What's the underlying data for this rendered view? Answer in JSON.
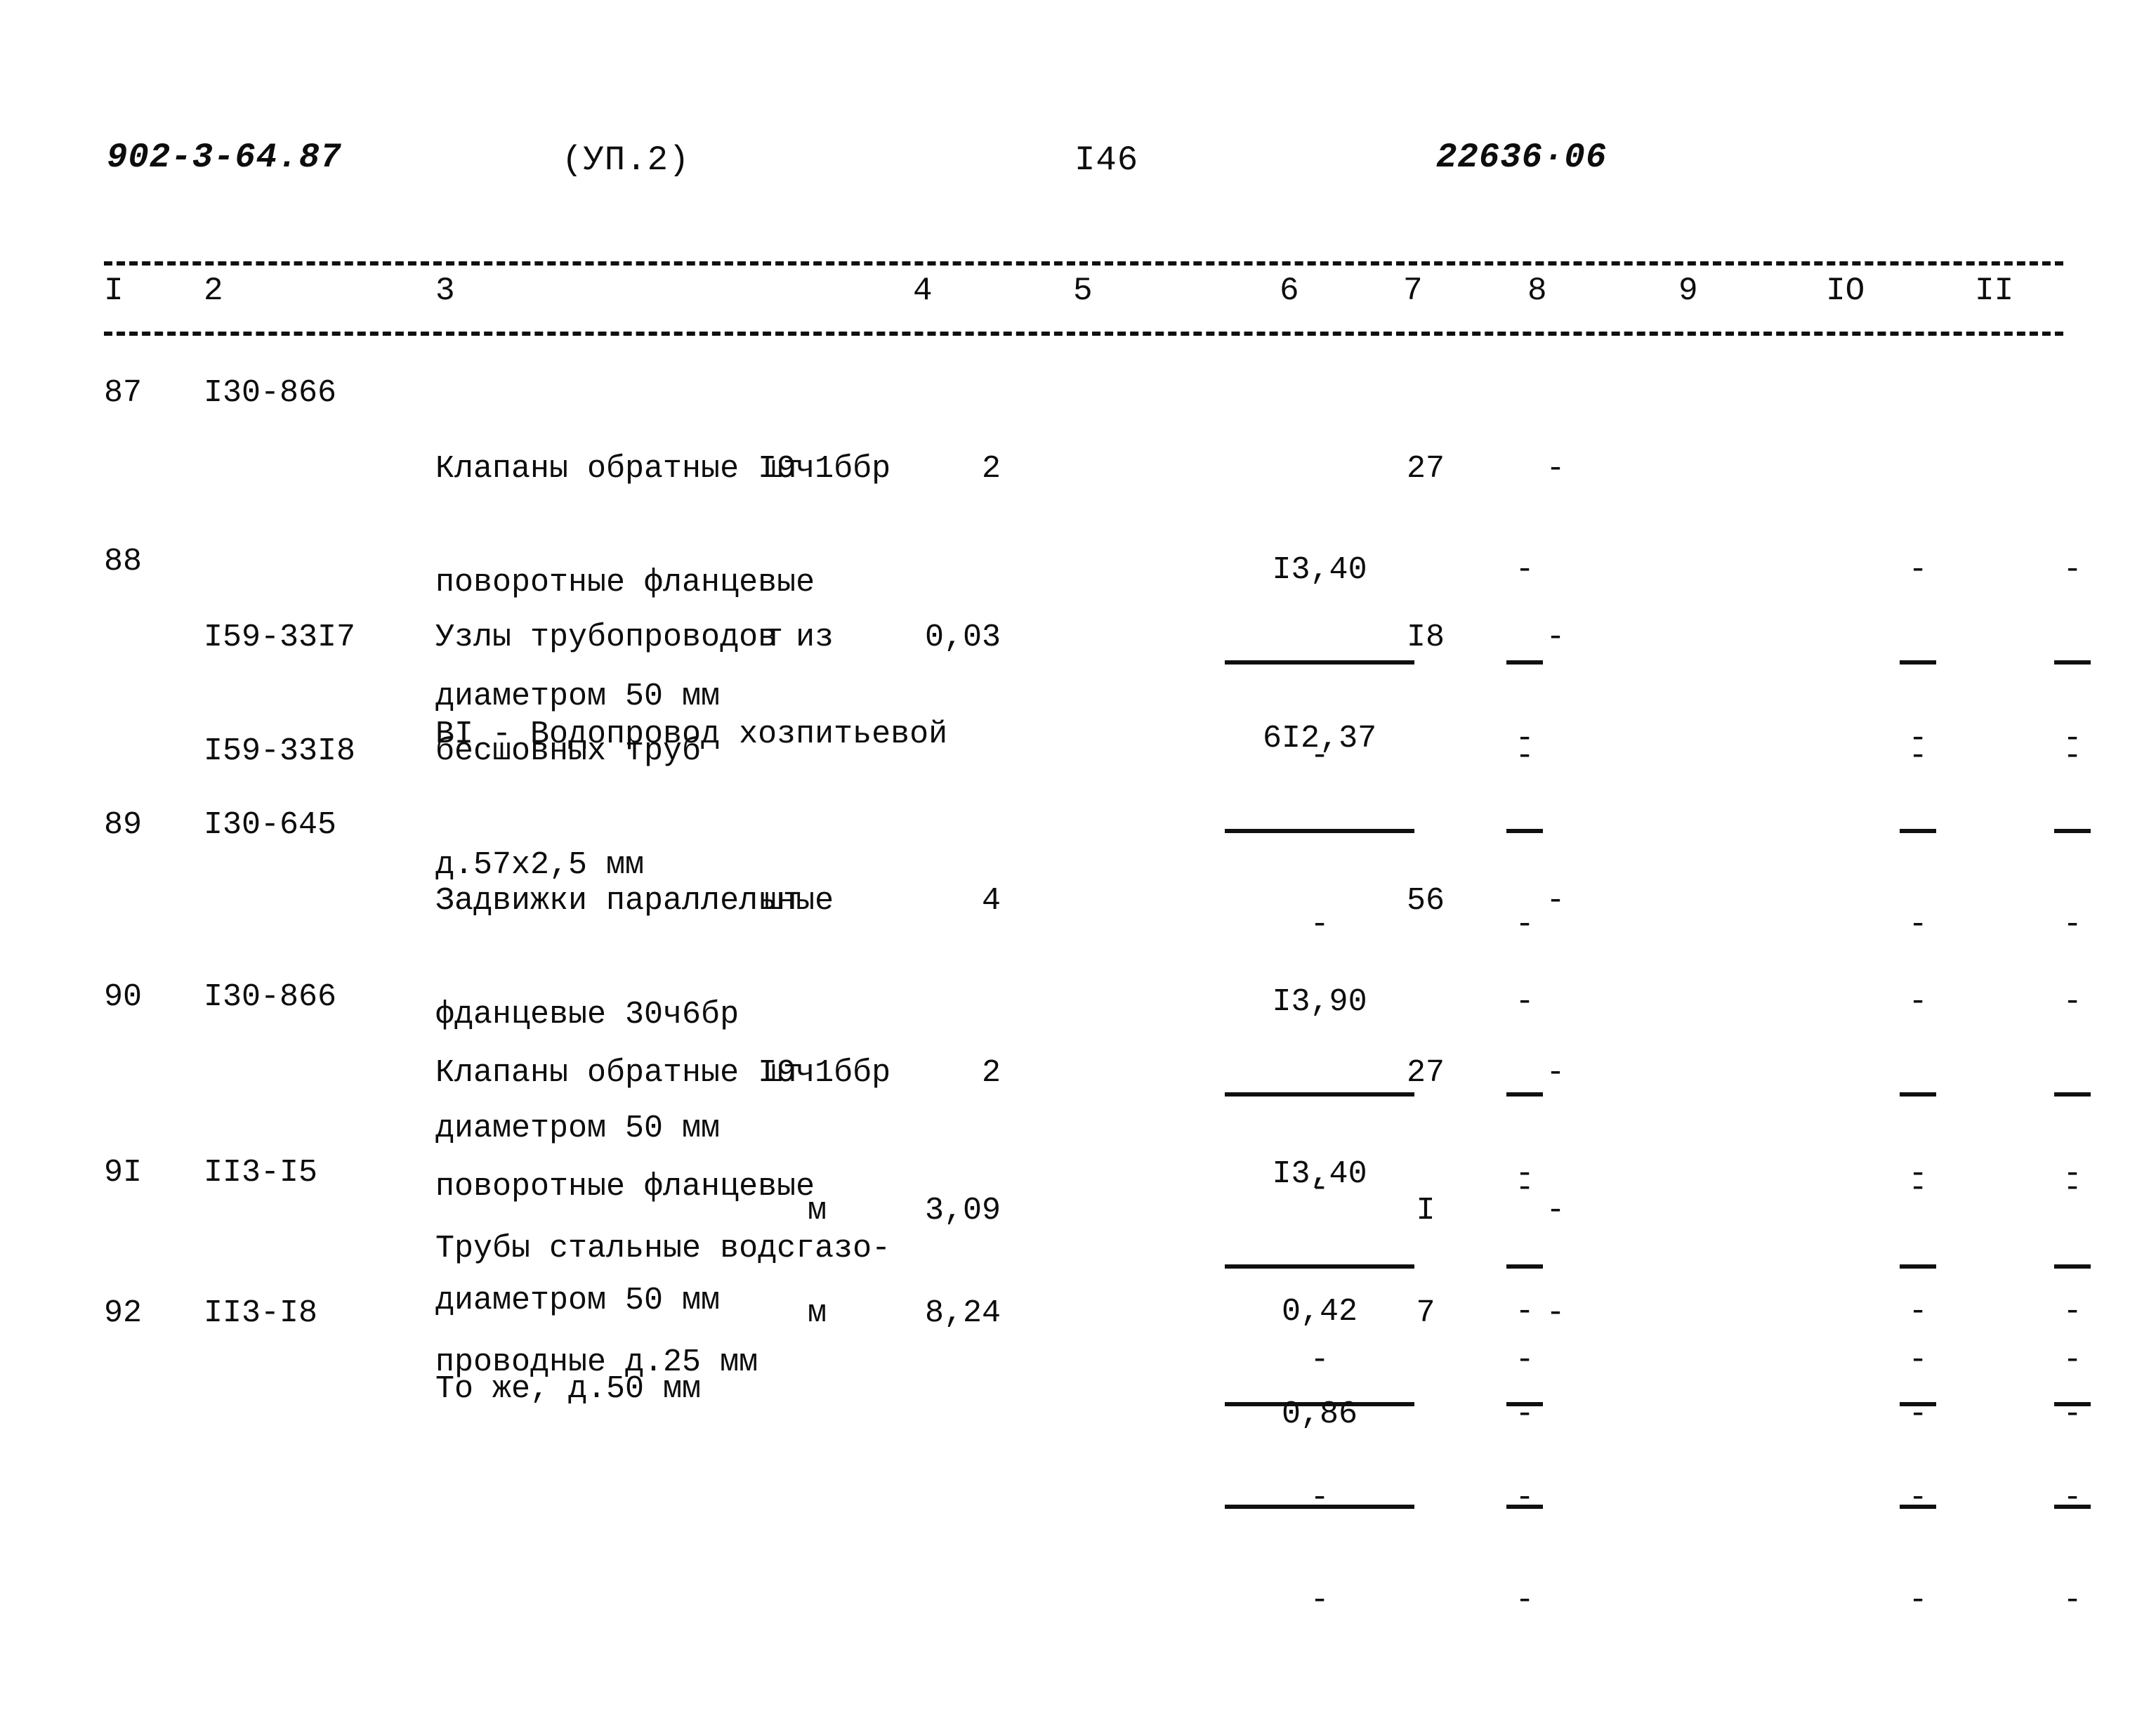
{
  "header": {
    "series_code": "902-3-64.87",
    "part_label": "(УП.2)",
    "page_number": "I46",
    "doc_number": "22636·06"
  },
  "table": {
    "column_numbers": [
      "I",
      "2",
      "3",
      "4",
      "5",
      "6",
      "7",
      "8",
      "9",
      "IO",
      "II"
    ],
    "rows": [
      {
        "kind": "item",
        "no": "87",
        "code_line1": "I30-866",
        "code_line2": "",
        "desc_line1": "Клапаны обратные I9ч1ббр",
        "desc_line2": "поворотные фланцевые",
        "desc_line3": "диаметром 50 мм",
        "unit": "шт",
        "qty": "2",
        "col5_num": "I3,40",
        "col5_den": "-",
        "col6_num": "-",
        "col6_den": "-",
        "col7": "27",
        "col8": "-",
        "col9_num": "-",
        "col9_den": "-",
        "col10_num": "-",
        "col10_den": "-",
        "col11_num": "-",
        "col11_den": "-"
      },
      {
        "kind": "item",
        "no": "88",
        "code_line1": "I59-33I7",
        "code_line2": "I59-33I8",
        "desc_line1": "Узлы трубопроводов из",
        "desc_line2": "бесшовных труб",
        "desc_line3": "д.57х2,5 мм",
        "unit": "т",
        "qty": "0,03",
        "col5_num": "6I2,37",
        "col5_den": "-",
        "col6_num": "-",
        "col6_den": "-",
        "col7": "I8",
        "col8": "-",
        "col9_num": "-",
        "col9_den": "-",
        "col10_num": "-",
        "col10_den": "-",
        "col11_num": "-",
        "col11_den": "-"
      },
      {
        "kind": "section",
        "title": "BI - Водопровод хозпитьевой"
      },
      {
        "kind": "item",
        "no": "89",
        "code_line1": "I30-645",
        "code_line2": "",
        "desc_line1": "Задвижки параллельные",
        "desc_line2": "фданцевые 30ч6бр",
        "desc_line3": "диаметром 50 мм",
        "unit": "шт",
        "qty": "4",
        "col5_num": "I3,90",
        "col5_den": "-",
        "col6_num": "-",
        "col6_den": "-",
        "col7": "56",
        "col8": "-",
        "col9_num": "-",
        "col9_den": "-",
        "col10_num": "-",
        "col10_den": "-",
        "col11_num": "-",
        "col11_den": "-"
      },
      {
        "kind": "item",
        "no": "90",
        "code_line1": "I30-866",
        "code_line2": "",
        "desc_line1": "Клапаны обратные I9ч1ббр",
        "desc_line2": "поворотные фланцевые",
        "desc_line3": "диаметром 50 мм",
        "unit": "шт",
        "qty": "2",
        "col5_num": "I3,40",
        "col5_den": "-",
        "col6_num": "-",
        "col6_den": "-",
        "col7": "27",
        "col8": "-",
        "col9_num": "-",
        "col9_den": "-",
        "col10_num": "-",
        "col10_den": "-",
        "col11_num": "-",
        "col11_den": "-"
      },
      {
        "kind": "item2",
        "no": "9I",
        "code_line1": "II3-I5",
        "code_line2": "",
        "desc_line1": "Трубы стальные водсгазо-",
        "desc_line2": "проводные д.25 мм",
        "desc_line3": "",
        "unit": "м",
        "qty": "3,09",
        "col5_num": "0,42",
        "col5_den": "-",
        "col6_num": "-",
        "col6_den": "-",
        "col7": "I",
        "col8": "-",
        "col9_num": "-",
        "col9_den": "-",
        "col10_num": "-",
        "col10_den": "-",
        "col11_num": "-",
        "col11_den": "-"
      },
      {
        "kind": "item1",
        "no": "92",
        "code_line1": "II3-I8",
        "code_line2": "",
        "desc_line1": "То же, д.50 мм",
        "desc_line2": "",
        "desc_line3": "",
        "unit": "м",
        "qty": "8,24",
        "col5_num": "0,86",
        "col5_den": "-",
        "col6_num": "-",
        "col6_den": "-",
        "col7": "7",
        "col8": "-",
        "col9_num": "-",
        "col9_den": "-",
        "col10_num": "-",
        "col10_den": "-",
        "col11_num": "-",
        "col11_den": "-"
      }
    ]
  }
}
